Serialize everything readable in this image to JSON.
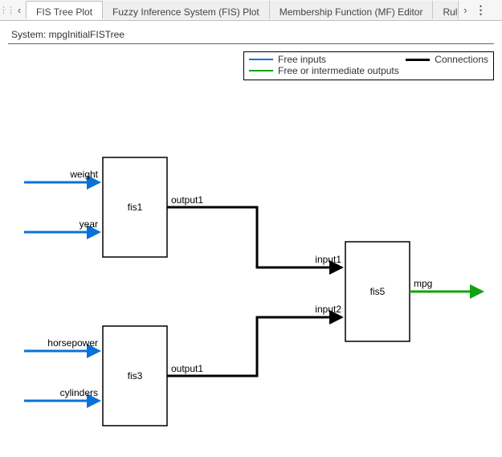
{
  "tabs": {
    "t0": "FIS Tree Plot",
    "t1": "Fuzzy Inference System (FIS) Plot",
    "t2": "Membership Function (MF) Editor",
    "t3": "Rule"
  },
  "system_label": "System: mpgInitialFISTree",
  "legend": {
    "free_inputs": "Free inputs",
    "connections": "Connections",
    "free_or_intermediate": "Free or intermediate outputs"
  },
  "nodes": {
    "fis1": {
      "name": "fis1",
      "inputs": [
        "weight",
        "year"
      ],
      "outputs": [
        "output1"
      ]
    },
    "fis3": {
      "name": "fis3",
      "inputs": [
        "horsepower",
        "cylinders"
      ],
      "outputs": [
        "output1"
      ]
    },
    "fis5": {
      "name": "fis5",
      "inputs": [
        "input1",
        "input2"
      ],
      "outputs": [
        "mpg"
      ]
    }
  }
}
